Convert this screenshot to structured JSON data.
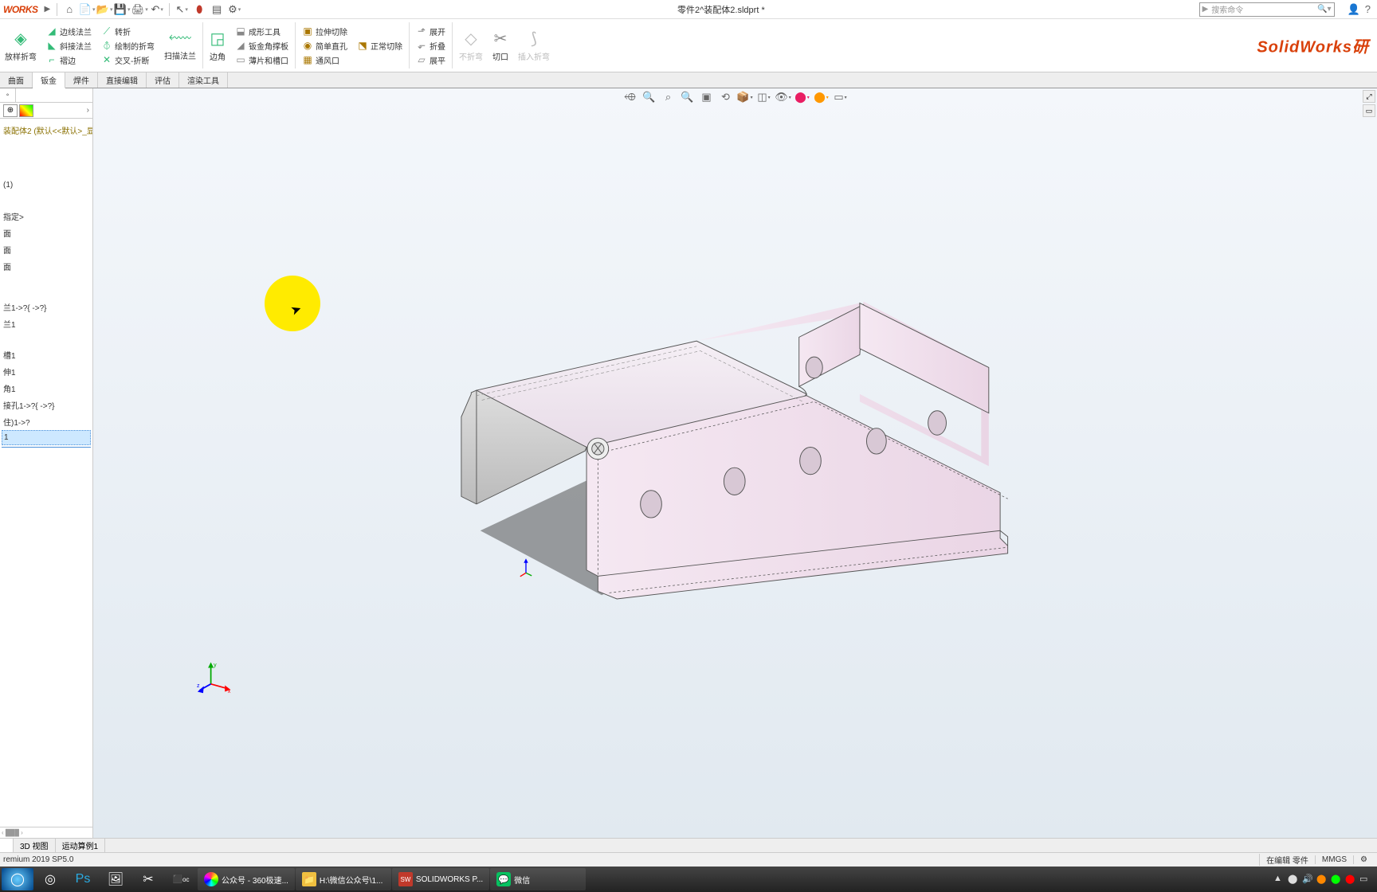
{
  "app": {
    "logo": "WORKS",
    "doc_title": "零件2^装配体2.sldprt *",
    "search_placeholder": "搜索命令",
    "watermark": "SolidWorks研"
  },
  "ribbon": {
    "big1": "放样折弯",
    "g1": [
      "边线法兰",
      "斜接法兰",
      "褶边"
    ],
    "g2": [
      "转折",
      "绘制的折弯",
      "交叉-折断"
    ],
    "big2": "扫描法兰",
    "big3": "边角",
    "g3": [
      "成形工具",
      "钣金角撑板",
      "薄片和槽口"
    ],
    "g4": [
      "拉伸切除",
      "简单直孔",
      "通风口"
    ],
    "g5": [
      "正常切除"
    ],
    "g6": [
      "展开",
      "折叠",
      "展平"
    ],
    "big4": "不折弯",
    "big5": "切口",
    "big6": "插入折弯"
  },
  "tabs": [
    "曲面",
    "钣金",
    "焊件",
    "直接编辑",
    "评估",
    "渲染工具"
  ],
  "tree": {
    "root": "装配体2 (默认<<默认>_显",
    "items": [
      "(1)",
      "指定>",
      "面",
      "面",
      "面",
      "",
      "兰1->?{ ->?}",
      "兰1",
      "",
      "槽1",
      "",
      "伸1",
      "",
      "角1",
      "接孔1->?{ ->?}",
      "住)1->?"
    ],
    "selected": "1"
  },
  "bottom_tabs": [
    "",
    "3D 视图",
    "运动算例1"
  ],
  "status": {
    "left": "remium 2019 SP5.0",
    "edit": "在编辑 零件",
    "units": "MMGS"
  },
  "taskbar": {
    "apps": [
      {
        "label": "公众号 - 360极速...",
        "color": "#4285f4"
      },
      {
        "label": "H:\\微信公众号\\1...",
        "color": "#f0c040"
      },
      {
        "label": "SOLIDWORKS P...",
        "color": "#c0392b"
      },
      {
        "label": "微信",
        "color": "#07c160"
      }
    ]
  },
  "triad": {
    "x": "x",
    "y": "y",
    "z": "z"
  }
}
